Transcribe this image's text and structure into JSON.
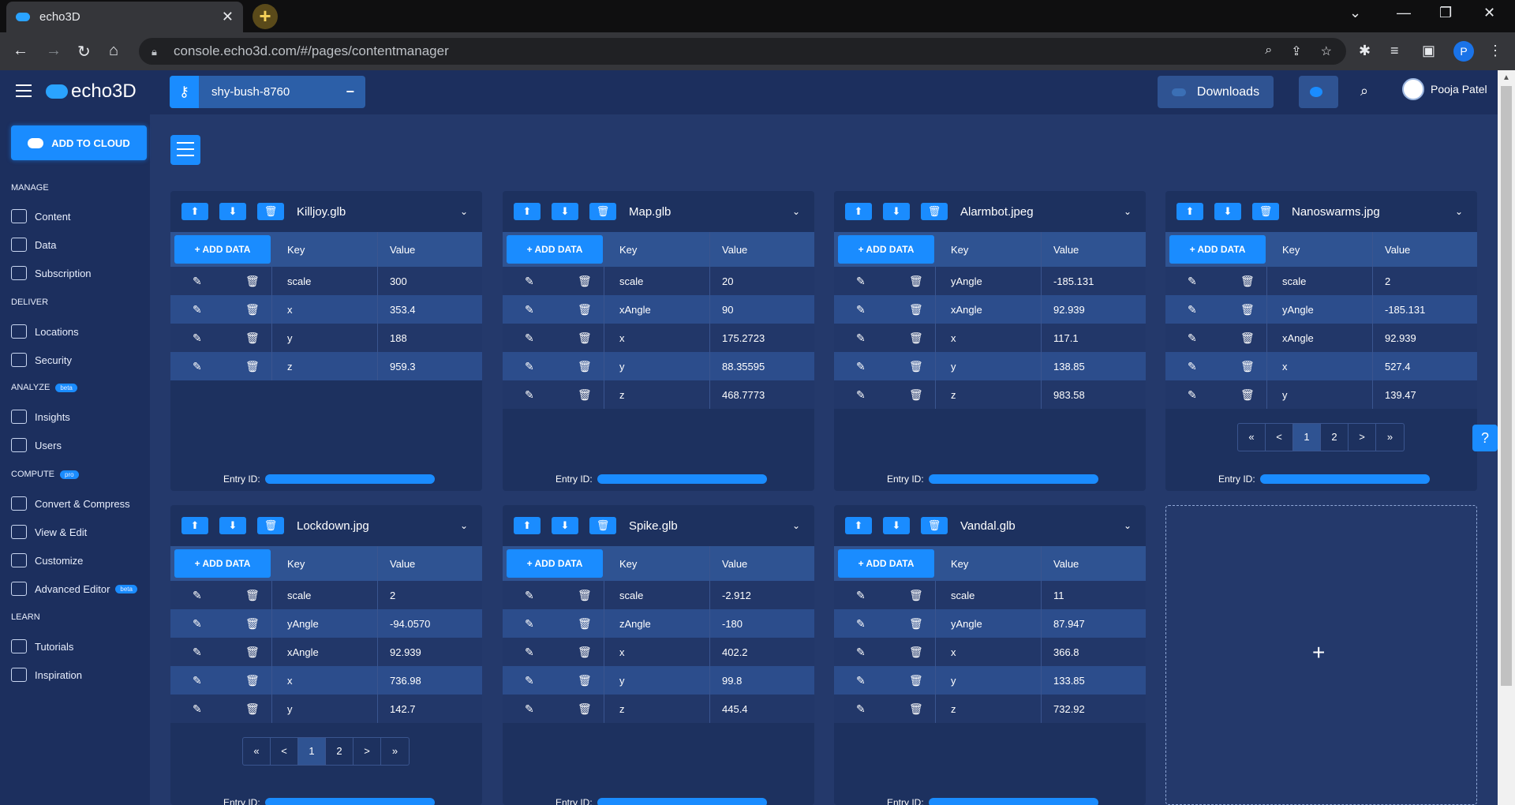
{
  "browser": {
    "tab_title": "echo3D",
    "url": "console.echo3d.com/#/pages/contentmanager",
    "profile_initial": "P"
  },
  "header": {
    "logo": "echo3D",
    "key_label": "shy-bush-8760",
    "downloads": "Downloads",
    "user_name": "Pooja Patel"
  },
  "sidebar": {
    "add_to_cloud": "ADD TO CLOUD",
    "manage": "MANAGE",
    "content": "Content",
    "data": "Data",
    "subscription": "Subscription",
    "deliver": "DELIVER",
    "locations": "Locations",
    "security": "Security",
    "analyze": "ANALYZE",
    "beta": "beta",
    "insights": "Insights",
    "users": "Users",
    "compute": "COMPUTE",
    "pro": "pro",
    "convert": "Convert & Compress",
    "view_edit": "View & Edit",
    "customize": "Customize",
    "advanced_editor": "Advanced Editor",
    "learn": "LEARN",
    "tutorials": "Tutorials",
    "inspiration": "Inspiration"
  },
  "common": {
    "add_data": "+ ADD DATA",
    "key": "Key",
    "value": "Value",
    "entry_id": "Entry ID:",
    "pager": [
      "«",
      "<",
      "1",
      "2",
      ">",
      "»"
    ]
  },
  "cards": [
    {
      "title": "Killjoy.glb",
      "rows": [
        [
          "scale",
          "300"
        ],
        [
          "x",
          "353.4"
        ],
        [
          "y",
          "188"
        ],
        [
          "z",
          "959.3"
        ]
      ]
    },
    {
      "title": "Map.glb",
      "rows": [
        [
          "scale",
          "20"
        ],
        [
          "xAngle",
          "90"
        ],
        [
          "x",
          "175.2723"
        ],
        [
          "y",
          "88.35595"
        ],
        [
          "z",
          "468.7773"
        ]
      ]
    },
    {
      "title": "Alarmbot.jpeg",
      "rows": [
        [
          "yAngle",
          "-185.131"
        ],
        [
          "xAngle",
          "92.939"
        ],
        [
          "x",
          "117.1"
        ],
        [
          "y",
          "138.85"
        ],
        [
          "z",
          "983.58"
        ]
      ]
    },
    {
      "title": "Nanoswarms.jpg",
      "rows": [
        [
          "scale",
          "2"
        ],
        [
          "yAngle",
          "-185.131"
        ],
        [
          "xAngle",
          "92.939"
        ],
        [
          "x",
          "527.4"
        ],
        [
          "y",
          "139.47"
        ]
      ]
    },
    {
      "title": "Lockdown.jpg",
      "rows": [
        [
          "scale",
          "2"
        ],
        [
          "yAngle",
          "-94.0570"
        ],
        [
          "xAngle",
          "92.939"
        ],
        [
          "x",
          "736.98"
        ],
        [
          "y",
          "142.7"
        ]
      ]
    },
    {
      "title": "Spike.glb",
      "rows": [
        [
          "scale",
          "-2.912"
        ],
        [
          "zAngle",
          "-180"
        ],
        [
          "x",
          "402.2"
        ],
        [
          "y",
          "99.8"
        ],
        [
          "z",
          "445.4"
        ]
      ]
    },
    {
      "title": "Vandal.glb",
      "rows": [
        [
          "scale",
          "11"
        ],
        [
          "yAngle",
          "87.947"
        ],
        [
          "x",
          "366.8"
        ],
        [
          "y",
          "133.85"
        ],
        [
          "z",
          "732.92"
        ]
      ]
    }
  ],
  "add_card_symbol": "+",
  "help_symbol": "?"
}
